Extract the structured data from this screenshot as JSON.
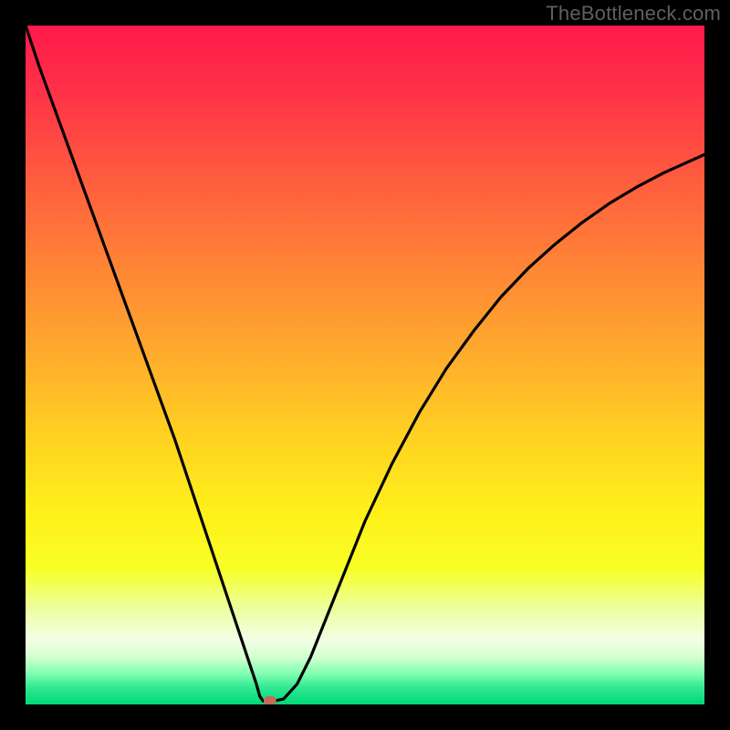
{
  "watermark": "TheBottleneck.com",
  "chart_data": {
    "type": "line",
    "title": "",
    "xlabel": "",
    "ylabel": "",
    "xlim": [
      0,
      100
    ],
    "ylim": [
      0,
      100
    ],
    "grid": false,
    "legend": false,
    "marker": {
      "x_pct": 36,
      "y_pct": 0,
      "color": "#c76a5a"
    },
    "series": [
      {
        "name": "curve",
        "color": "#000000",
        "x_pct": [
          0,
          2,
          4,
          6,
          8,
          10,
          12,
          14,
          16,
          18,
          20,
          22,
          24,
          26,
          28,
          30,
          32,
          33,
          34,
          34.5,
          35,
          36,
          38,
          40,
          42,
          44,
          46,
          48,
          50,
          54,
          58,
          62,
          66,
          70,
          74,
          78,
          82,
          86,
          90,
          94,
          98,
          100
        ],
        "y_pct": [
          100,
          94,
          88.5,
          83,
          77.5,
          72,
          66.5,
          61,
          55.5,
          50,
          44.5,
          39,
          33,
          27,
          21,
          15,
          9,
          6,
          3,
          1.2,
          0.5,
          0.4,
          0.8,
          3,
          7,
          12,
          17,
          22,
          27,
          35.5,
          43,
          49.5,
          55,
          60,
          64.2,
          67.8,
          71,
          73.8,
          76.2,
          78.3,
          80.1,
          81
        ]
      }
    ],
    "background_gradient": {
      "stops": [
        {
          "offset": 0.0,
          "color": "#ff1a4b"
        },
        {
          "offset": 0.1,
          "color": "#ff3248"
        },
        {
          "offset": 0.22,
          "color": "#ff5a3f"
        },
        {
          "offset": 0.35,
          "color": "#ff8336"
        },
        {
          "offset": 0.48,
          "color": "#ffaa2d"
        },
        {
          "offset": 0.6,
          "color": "#ffd022"
        },
        {
          "offset": 0.72,
          "color": "#fff11a"
        },
        {
          "offset": 0.8,
          "color": "#f7ff26"
        },
        {
          "offset": 0.86,
          "color": "#ecffa2"
        },
        {
          "offset": 0.905,
          "color": "#f3ffe5"
        },
        {
          "offset": 0.93,
          "color": "#d4ffd0"
        },
        {
          "offset": 0.955,
          "color": "#80ffb0"
        },
        {
          "offset": 0.975,
          "color": "#30e892"
        },
        {
          "offset": 1.0,
          "color": "#00d878"
        }
      ]
    }
  }
}
